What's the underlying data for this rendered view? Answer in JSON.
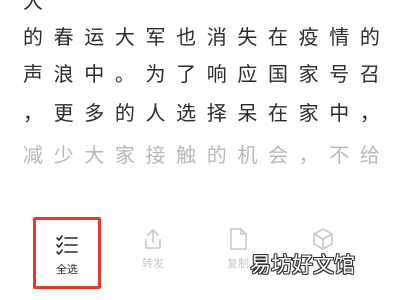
{
  "article": {
    "lines": [
      [
        "大",
        "",
        "",
        "",
        "",
        "",
        "",
        "",
        "",
        "",
        ""
      ],
      [
        "的",
        "春",
        "运",
        "大",
        "军",
        "也",
        "消",
        "失",
        "在",
        "疫",
        "情",
        "的"
      ],
      [
        "声",
        "浪",
        "中",
        "。",
        "为",
        "了",
        "响",
        "应",
        "国",
        "家",
        "号",
        "召"
      ],
      [
        "，",
        "更",
        "多",
        "的",
        "人",
        "选",
        "择",
        "呆",
        "在",
        "家",
        "中",
        "，"
      ],
      [
        "减",
        "少",
        "大",
        "家",
        "接",
        "触",
        "的",
        "机",
        "会",
        "，",
        "不",
        "给"
      ]
    ]
  },
  "toolbar": {
    "select_all_label": "全选",
    "share_label": "转发",
    "copy_label": "复制"
  },
  "watermark": {
    "text": "易坊好文馆"
  },
  "colors": {
    "highlight_border": "#e53a2a",
    "text": "#2b2b2b",
    "disabled": "#c8c8c8"
  }
}
